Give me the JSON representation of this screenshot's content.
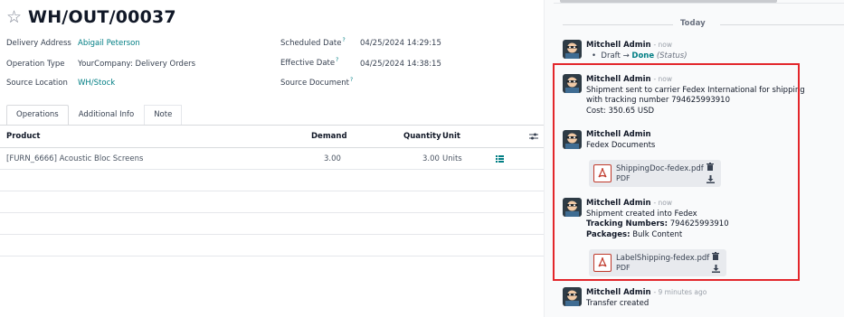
{
  "record": {
    "title": "WH/OUT/00037",
    "fields_left": [
      {
        "label": "Delivery Address",
        "value": "Abigail Peterson",
        "is_link": true
      },
      {
        "label": "Operation Type",
        "value": "YourCompany: Delivery Orders",
        "is_link": false
      },
      {
        "label": "Source Location",
        "value": "WH/Stock",
        "is_link": true
      }
    ],
    "fields_right": [
      {
        "label": "Scheduled Date",
        "help": "?",
        "value": "04/25/2024 14:29:15"
      },
      {
        "label": "Effective Date",
        "help": "?",
        "value": "04/25/2024 14:38:15"
      },
      {
        "label": "Source Document",
        "help": "?",
        "value": ""
      }
    ]
  },
  "tabs": [
    "Operations",
    "Additional Info",
    "Note"
  ],
  "table": {
    "headers": {
      "product": "Product",
      "demand": "Demand",
      "quantity": "Quantity",
      "unit": "Unit"
    },
    "rows": [
      {
        "product": "[FURN_6666] Acoustic Bloc Screens",
        "demand": "3.00",
        "quantity": "3.00",
        "unit": "Units"
      }
    ]
  },
  "chatter": {
    "date_separator": "Today",
    "messages": [
      {
        "author": "Mitchell Admin",
        "time": "- now",
        "status_from": "Draft",
        "status_arrow": "→",
        "status_to": "Done",
        "status_field": "(Status)",
        "bullet": "•"
      },
      {
        "author": "Mitchell Admin",
        "time": "- now",
        "text": "Shipment sent to carrier Fedex International for shipping with tracking number 794625993910",
        "cost": "Cost: 350.65 USD"
      },
      {
        "author": "Mitchell Admin",
        "time": "",
        "text": "Fedex Documents",
        "attachment": {
          "name": "ShippingDoc-fedex.pdf",
          "type": "PDF"
        }
      },
      {
        "author": "Mitchell Admin",
        "time": "- now",
        "text": "Shipment created into Fedex",
        "tracking_label": "Tracking Numbers:",
        "tracking_value": "794625993910",
        "packages_label": "Packages:",
        "packages_value": "Bulk Content",
        "attachment": {
          "name": "LabelShipping-fedex.pdf",
          "type": "PDF"
        }
      },
      {
        "author": "Mitchell Admin",
        "time": "- 9 minutes ago",
        "text": "Transfer created"
      }
    ]
  },
  "colors": {
    "accent": "#017e84",
    "highlight": "#e3262b",
    "pdf_red": "#c0392b"
  },
  "icons": {
    "favorite": "star-icon",
    "settings": "sliders-icon",
    "list": "list-icon",
    "pdf": "pdf-icon",
    "trash": "trash-icon",
    "download": "download-icon"
  }
}
